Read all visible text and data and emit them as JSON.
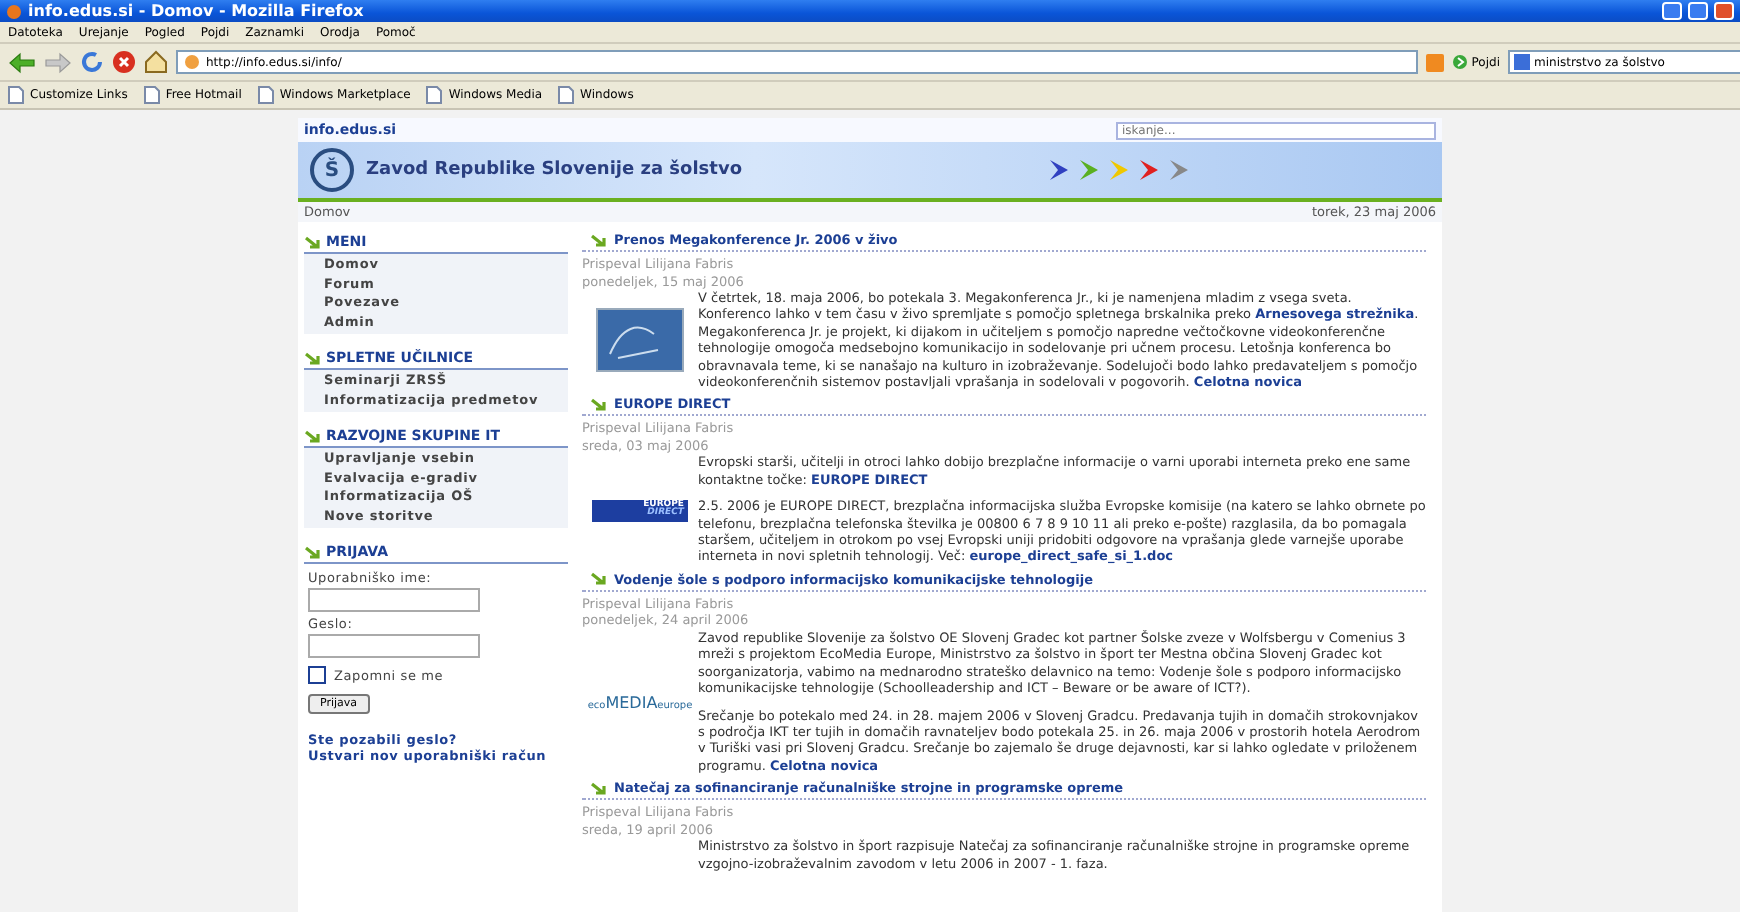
{
  "window": {
    "title": "info.edus.si - Domov - Mozilla Firefox"
  },
  "menu": [
    {
      "label": "Datoteka"
    },
    {
      "label": "Urejanje"
    },
    {
      "label": "Pogled"
    },
    {
      "label": "Pojdi"
    },
    {
      "label": "Zaznamki"
    },
    {
      "label": "Orodja"
    },
    {
      "label": "Pomoč"
    }
  ],
  "toolbar": {
    "address": "http://info.edus.si/info/",
    "go_label": "Pojdi",
    "search_value": "ministrstvo za šolstvo"
  },
  "bookmarks": [
    {
      "label": "Customize Links"
    },
    {
      "label": "Free Hotmail"
    },
    {
      "label": "Windows Marketplace"
    },
    {
      "label": "Windows Media"
    },
    {
      "label": "Windows"
    }
  ],
  "site": {
    "name": "info.edus.si",
    "search_placeholder": "iskanje...",
    "logo_letter": "Š",
    "banner_title": "Zavod Republike Slovenije za šolstvo",
    "breadcrumb": "Domov",
    "date": "torek, 23 maj 2006"
  },
  "sidebar": {
    "sections": [
      {
        "title": "MENI",
        "items": [
          "Domov",
          "Forum",
          "Povezave",
          "Admin"
        ]
      },
      {
        "title": "SPLETNE UČILNICE",
        "items": [
          "Seminarji ZRSŠ",
          "Informatizacija predmetov"
        ]
      },
      {
        "title": "RAZVOJNE SKUPINE IT",
        "items": [
          "Upravljanje vsebin",
          "Evalvacija e-gradiv",
          "Informatizacija OŠ",
          "Nove storitve"
        ]
      }
    ],
    "login": {
      "title": "PRIJAVA",
      "username_label": "Uporabniško ime:",
      "password_label": "Geslo:",
      "remember_label": "Zapomni se me",
      "remember": {
        "checked": false
      },
      "button": "Prijava",
      "links": [
        "Ste pozabili geslo?",
        "Ustvari nov uporabniški račun"
      ]
    }
  },
  "articles": [
    {
      "title": "Prenos Megakonference Jr. 2006 v živo",
      "author": "Prispeval Lilijana Fabris",
      "date": "ponedeljek, 15 maj 2006",
      "image": {
        "kind": "conference"
      },
      "paragraphs": [
        [
          {
            "text": "V četrtek, 18. maja 2006, bo potekala 3. Megakonferenca Jr., ki je namenjena mladim z vsega sveta. Konferenco lahko v tem času v živo spremljate s pomočjo spletnega brskalnika preko "
          },
          {
            "link": "Arnesovega strežnika"
          },
          {
            "text": ". Megakonferenca Jr. je projekt, ki dijakom in učiteljem s pomočjo napredne večtočkovne videokonferenčne tehnologije omogoča medsebojno komunikacijo in sodelovanje pri učnem procesu. Letošnja konferenca bo obravnavala teme, ki se nanašajo na kulturo in izobraževanje. Sodelujoči bodo lahko predavateljem s pomočjo videokonferenčnih sistemov postavljali vprašanja in sodelovali v pogovorih. "
          },
          {
            "link": "Celotna novica"
          }
        ]
      ]
    },
    {
      "title": "EUROPE DIRECT",
      "author": "Prispeval Lilijana Fabris",
      "date": "sreda, 03 maj 2006",
      "image": {
        "kind": "europe",
        "logo_text": [
          "EUROPE",
          "DIRECT"
        ]
      },
      "paragraphs": [
        [
          {
            "text": "Evropski starši, učitelji in otroci lahko dobijo brezplačne informacije o varni uporabi interneta preko ene same kontaktne točke: "
          },
          {
            "link": "EUROPE DIRECT"
          }
        ],
        [
          {
            "text": "2.5. 2006 je EUROPE DIRECT, brezplačna informacijska služba Evropske komisije (na katero se lahko obrnete po telefonu, brezplačna telefonska številka je 00800 6 7 8 9 10 11 ali preko e-pošte) razglasila, da bo pomagala staršem, učiteljem in otrokom po vsej Evropski uniji pridobiti odgovore na vprašanja glede varnejše uporabe interneta in novi spletnih tehnologij. Več: "
          },
          {
            "link": "europe_direct_safe_si_1.doc"
          }
        ]
      ]
    },
    {
      "title": "Vodenje šole s podporo informacijsko komunikacijske tehnologije",
      "author": "Prispeval Lilijana Fabris",
      "date": "ponedeljek, 24 april 2006",
      "image": {
        "kind": "ecomedia",
        "logo_text": [
          "eco",
          "MEDIA",
          "europe"
        ]
      },
      "paragraphs": [
        [
          {
            "text": "Zavod republike Slovenije za šolstvo OE Slovenj Gradec kot partner Šolske zveze v Wolfsbergu v Comenius 3 mreži s projektom EcoMedia Europe, Ministrstvo za šolstvo in šport ter Mestna občina Slovenj Gradec kot soorganizatorja, vabimo na mednarodno strateško delavnico na temo: Vodenje šole s podporo informacijsko komunikacijske tehnologije (Schoolleadership and ICT – Beware or be aware of ICT?)."
          }
        ],
        [
          {
            "text": "Srečanje bo potekalo med 24. in 28. majem 2006 v Slovenj Gradcu. Predavanja tujih in domačih strokovnjakov s področja IKT ter tujih in domačih ravnateljev bodo potekala 25. in 26. maja 2006 v prostorih hotela Aerodrom v Turiški vasi pri Slovenj Gradcu. Srečanje bo zajemalo še druge dejavnosti, kar si lahko ogledate v priloženem programu. "
          },
          {
            "link": "Celotna novica"
          }
        ]
      ]
    },
    {
      "title": "Natečaj za sofinanciranje računalniške strojne in programske opreme",
      "author": "Prispeval Lilijana Fabris",
      "date": "sreda, 19 april 2006",
      "paragraphs": [
        [
          {
            "text": "Ministrstvo za šolstvo in šport razpisuje Natečaj za sofinanciranje računalniške strojne in programske opreme vzgojno-izobraževalnim zavodom v letu 2006 in 2007 - 1. faza."
          }
        ]
      ]
    }
  ]
}
